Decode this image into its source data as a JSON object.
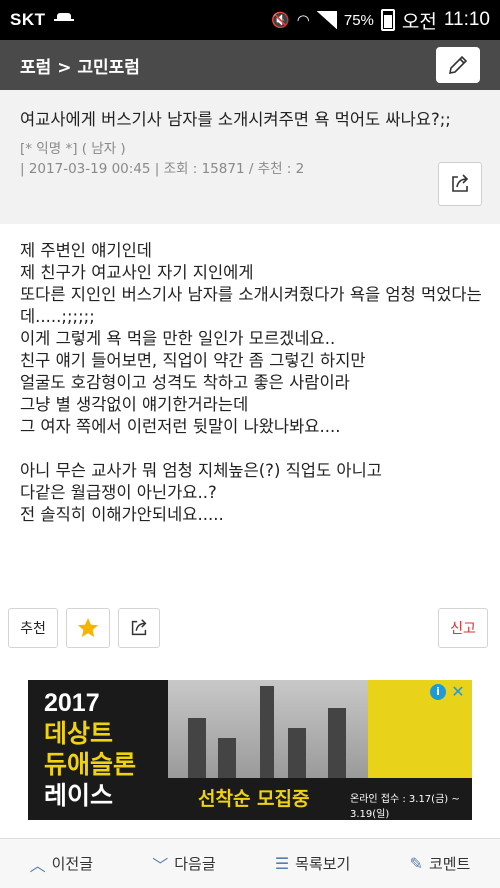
{
  "status_bar": {
    "carrier": "SKT",
    "battery_percent": "75%",
    "ampm": "오전",
    "time": "11:10"
  },
  "header": {
    "breadcrumb": "포럼 > 고민포럼",
    "edit_icon": "pencil-icon"
  },
  "post": {
    "title": "여교사에게 버스기사 남자를 소개시켜주면 욕 먹어도 싸나요?;;",
    "author": "[* 익명 *] ( 남자 )",
    "meta": "| 2017-03-19 00:45 | 조회 : 15871 / 추천 : 2",
    "share_icon": "share-icon",
    "body": [
      "제 주변인 얘기인데",
      "제 친구가 여교사인 자기 지인에게",
      "또다른 지인인 버스기사 남자를 소개시켜줬다가 욕을 엄청 먹었다는데.....;;;;;;",
      "이게 그렇게 욕 먹을 만한 일인가 모르겠네요..",
      "친구 얘기 들어보면, 직업이 약간 좀 그렇긴 하지만",
      "얼굴도 호감형이고 성격도 착하고 좋은 사람이라",
      "그냥 별 생각없이 얘기한거라는데",
      "그 여자 쪽에서 이런저런 뒷말이 나왔나봐요....",
      "",
      "아니 무슨 교사가 뭐 엄청 지체높은(?) 직업도 아니고",
      "다같은 월급쟁이 아닌가요..?",
      "전 솔직히 이해가안되네요....."
    ]
  },
  "actions": {
    "recommend_label": "추천",
    "report_label": "신고"
  },
  "ad": {
    "title_line1": "2017",
    "title_line2": "데상트",
    "title_line3": "듀애슬론",
    "title_line4": "레이스",
    "headline": "선착순 모집중",
    "dates": "온라인 접수 : 3.17(금) ~ 3.19(일)"
  },
  "bottom_nav": {
    "prev": "이전글",
    "next": "다음글",
    "list": "목록보기",
    "comment": "코멘트"
  }
}
